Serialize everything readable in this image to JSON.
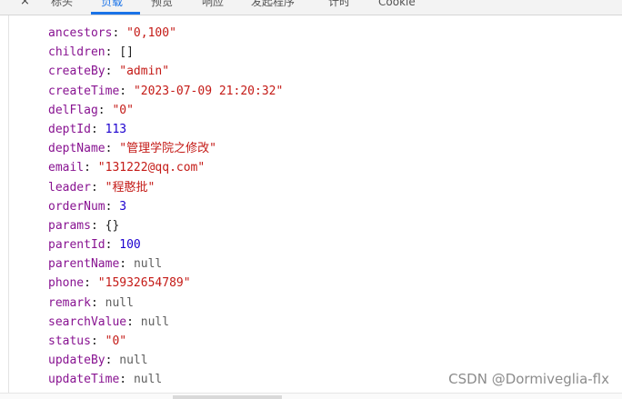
{
  "tabs": {
    "close_glyph": "×",
    "items": [
      {
        "label": "标头",
        "active": false
      },
      {
        "label": "负载",
        "active": true
      },
      {
        "label": "预览",
        "active": false
      },
      {
        "label": "响应",
        "active": false
      },
      {
        "label": "发起程序",
        "active": false
      },
      {
        "label": "计时",
        "active": false
      },
      {
        "label": "Cookie",
        "active": false
      }
    ]
  },
  "response": {
    "fields": [
      {
        "key": "ancestors",
        "value": "\"0,100\"",
        "type": "string"
      },
      {
        "key": "children",
        "value": "[]",
        "type": "plain"
      },
      {
        "key": "createBy",
        "value": "\"admin\"",
        "type": "string"
      },
      {
        "key": "createTime",
        "value": "\"2023-07-09 21:20:32\"",
        "type": "string"
      },
      {
        "key": "delFlag",
        "value": "\"0\"",
        "type": "string"
      },
      {
        "key": "deptId",
        "value": "113",
        "type": "number"
      },
      {
        "key": "deptName",
        "value": "\"管理学院之修改\"",
        "type": "string"
      },
      {
        "key": "email",
        "value": "\"131222@qq.com\"",
        "type": "string"
      },
      {
        "key": "leader",
        "value": "\"程憨批\"",
        "type": "string"
      },
      {
        "key": "orderNum",
        "value": "3",
        "type": "number"
      },
      {
        "key": "params",
        "value": "{}",
        "type": "plain"
      },
      {
        "key": "parentId",
        "value": "100",
        "type": "number"
      },
      {
        "key": "parentName",
        "value": "null",
        "type": "null"
      },
      {
        "key": "phone",
        "value": "\"15932654789\"",
        "type": "string"
      },
      {
        "key": "remark",
        "value": "null",
        "type": "null"
      },
      {
        "key": "searchValue",
        "value": "null",
        "type": "null"
      },
      {
        "key": "status",
        "value": "\"0\"",
        "type": "string"
      },
      {
        "key": "updateBy",
        "value": "null",
        "type": "null"
      },
      {
        "key": "updateTime",
        "value": "null",
        "type": "null"
      }
    ]
  },
  "watermark": "CSDN @Dormiveglia-flx",
  "colors": {
    "key": "#881391",
    "string": "#c41a16",
    "number": "#1c00cf",
    "null": "#5e5e5e",
    "accent": "#1a73e8"
  }
}
